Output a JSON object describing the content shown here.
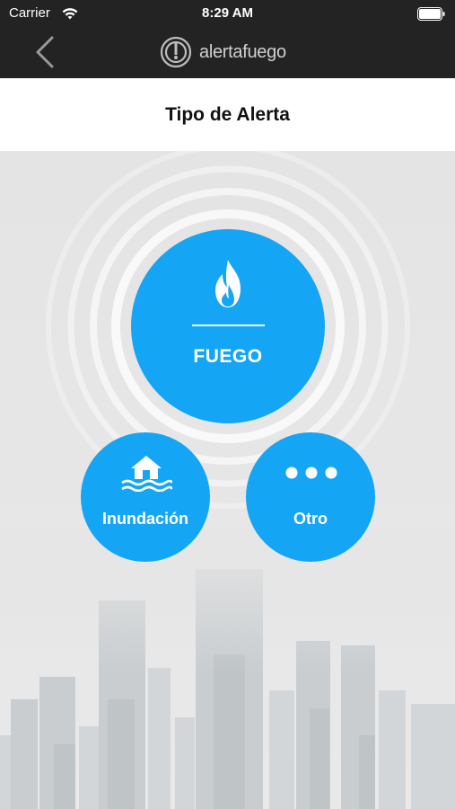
{
  "status_bar": {
    "carrier": "Carrier",
    "time": "8:29 AM"
  },
  "nav": {
    "brand": "alertafuego"
  },
  "page": {
    "title": "Tipo de Alerta"
  },
  "alert_types": {
    "fire": {
      "label": "FUEGO",
      "icon": "flame-icon"
    },
    "flood": {
      "label": "Inundación",
      "icon": "flooded-house-icon"
    },
    "other": {
      "label": "Otro",
      "icon": "more-dots-icon"
    }
  },
  "colors": {
    "header_bg": "#232323",
    "accent": "#14a5f5",
    "background": "#e6e6e6"
  }
}
